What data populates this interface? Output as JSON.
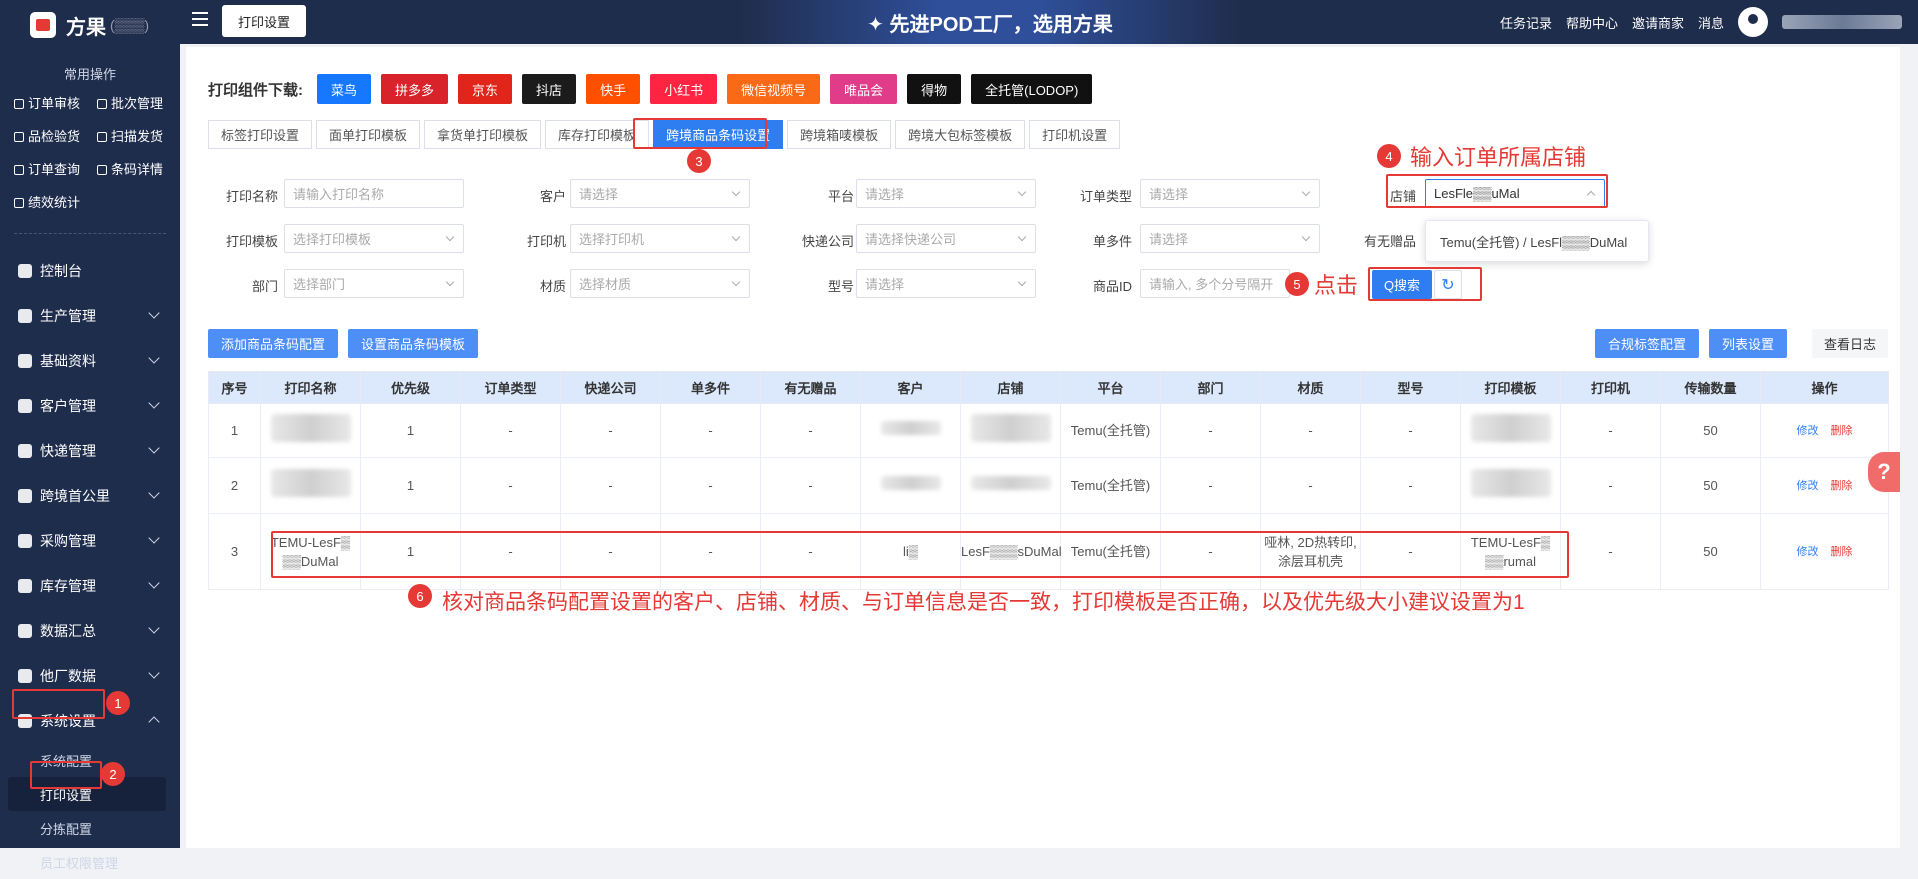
{
  "app": {
    "name": "方果"
  },
  "quick": {
    "title": "常用操作",
    "items": [
      "订单审核",
      "批次管理",
      "品检验货",
      "扫描发货",
      "订单查询",
      "条码详情",
      "绩效统计"
    ]
  },
  "menu": [
    "控制台",
    "生产管理",
    "基础资料",
    "客户管理",
    "快递管理",
    "跨境首公里",
    "采购管理",
    "库存管理",
    "数据汇总",
    "他厂数据",
    "系统设置"
  ],
  "submenu": [
    "系统配置",
    "打印设置",
    "分拣配置",
    "员工权限管理"
  ],
  "topbar": {
    "tab": "打印设置",
    "banner": "✦ 先进POD工厂，选用方果",
    "links": [
      "任务记录",
      "帮助中心",
      "邀请商家",
      "消息"
    ]
  },
  "download": {
    "label": "打印组件下载:",
    "buttons": [
      {
        "label": "菜鸟",
        "color": "#1677ff"
      },
      {
        "label": "拼多多",
        "color": "#d8232a"
      },
      {
        "label": "京东",
        "color": "#e1251b"
      },
      {
        "label": "抖店",
        "color": "#1b1b1b"
      },
      {
        "label": "快手",
        "color": "#ff5000"
      },
      {
        "label": "小红书",
        "color": "#ff2442"
      },
      {
        "label": "微信视频号",
        "color": "#fa6a16"
      },
      {
        "label": "唯品会",
        "color": "#e03c8a"
      },
      {
        "label": "得物",
        "color": "#111111"
      },
      {
        "label": "全托管(LODOP)",
        "color": "#111111"
      }
    ]
  },
  "tabs": [
    "标签打印设置",
    "面单打印模板",
    "拿货单打印模板",
    "库存打印模板",
    "跨境商品条码设置",
    "跨境箱唛模板",
    "跨境大包标签模板",
    "打印机设置"
  ],
  "filters": {
    "print_name": {
      "label": "打印名称",
      "placeholder": "请输入打印名称"
    },
    "customer": {
      "label": "客户",
      "placeholder": "请选择"
    },
    "platform": {
      "label": "平台",
      "placeholder": "请选择"
    },
    "order_type": {
      "label": "订单类型",
      "placeholder": "请选择"
    },
    "shop": {
      "label": "店铺",
      "value": "LesFle▒▒uMal"
    },
    "template": {
      "label": "打印模板",
      "placeholder": "选择打印模板"
    },
    "printer": {
      "label": "打印机",
      "placeholder": "选择打印机"
    },
    "express": {
      "label": "快递公司",
      "placeholder": "请选择快递公司"
    },
    "single_multi": {
      "label": "单多件",
      "placeholder": "请选择"
    },
    "gift": {
      "label": "有无赠品"
    },
    "dept": {
      "label": "部门",
      "placeholder": "选择部门"
    },
    "material": {
      "label": "材质",
      "placeholder": "选择材质"
    },
    "model": {
      "label": "型号",
      "placeholder": "请选择"
    },
    "product_id": {
      "label": "商品ID",
      "placeholder": "请输入, 多个分号隔开"
    }
  },
  "shop_popup": "Temu(全托管) / LesFl▒▒▒DuMal",
  "search_btn": "Q搜索",
  "actions": {
    "add": "添加商品条码配置",
    "set": "设置商品条码模板",
    "compliance": "合规标签配置",
    "list": "列表设置",
    "log": "查看日志"
  },
  "table": {
    "headers": [
      "序号",
      "打印名称",
      "优先级",
      "订单类型",
      "快递公司",
      "单多件",
      "有无赠品",
      "客户",
      "店铺",
      "平台",
      "部门",
      "材质",
      "型号",
      "打印模板",
      "打印机",
      "传输数量",
      "操作"
    ],
    "rows": [
      {
        "no": "1",
        "priority": "1",
        "order_type": "-",
        "express": "-",
        "single": "-",
        "gift": "-",
        "platform": "Temu(全托管)",
        "dept": "-",
        "material": "-",
        "model": "-",
        "printer": "-",
        "count": "50"
      },
      {
        "no": "2",
        "priority": "1",
        "order_type": "-",
        "express": "-",
        "single": "-",
        "gift": "-",
        "platform": "Temu(全托管)",
        "dept": "-",
        "material": "-",
        "model": "-",
        "printer": "-",
        "count": "50"
      },
      {
        "no": "3",
        "name": "TEMU-LesF▒ ▒▒DuMal",
        "priority": "1",
        "order_type": "-",
        "express": "-",
        "single": "-",
        "gift": "-",
        "customer": "li▒",
        "shop": "LesF▒▒▒sDuMal",
        "platform": "Temu(全托管)",
        "dept": "-",
        "material": "哑林, 2D热转印, 涂层耳机壳",
        "model": "-",
        "template": "TEMU-LesF▒ ▒▒rumal",
        "printer": "-",
        "count": "50"
      }
    ],
    "edit": "修改",
    "delete": "删除"
  },
  "annotations": {
    "b1": "1",
    "b2": "2",
    "b3": "3",
    "b4": "4",
    "b5": "5",
    "b6": "6",
    "a4": "输入订单所属店铺",
    "a5": "点击",
    "a6": "核对商品条码配置设置的客户、店铺、材质、与订单信息是否一致，打印模板是否正确，以及优先级大小建议设置为1"
  }
}
